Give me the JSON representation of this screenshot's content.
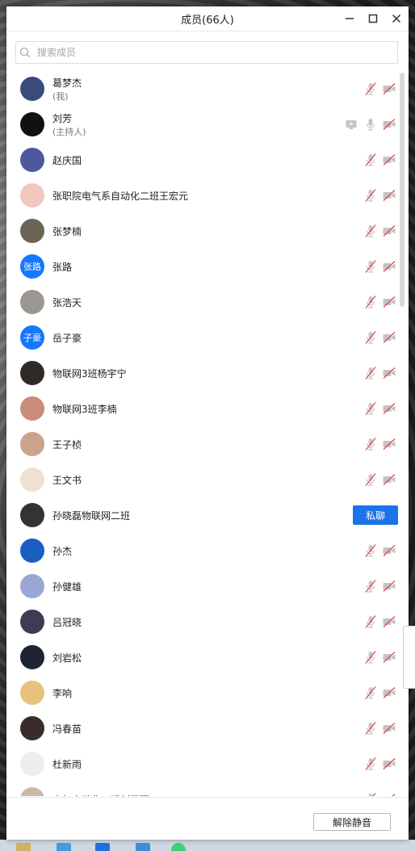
{
  "window": {
    "title": "成员(66人)"
  },
  "search": {
    "placeholder": "搜索成员"
  },
  "members": [
    {
      "name": "葛梦杰",
      "sub": "(我)",
      "avatar_color": "#3a4a7a",
      "avatar_text": "",
      "mic": "muted",
      "cam": "off"
    },
    {
      "name": "刘芳",
      "sub": "(主持人)",
      "avatar_color": "#111111",
      "avatar_text": "",
      "mic": "on",
      "cam": "off",
      "share": true
    },
    {
      "name": "赵庆国",
      "sub": "",
      "avatar_color": "#4a5a9a",
      "avatar_text": "",
      "mic": "muted",
      "cam": "off"
    },
    {
      "name": "张职院电气系自动化二班王宏元",
      "sub": "",
      "avatar_color": "#f2c7c0",
      "avatar_text": "",
      "mic": "muted",
      "cam": "off"
    },
    {
      "name": "张梦楠",
      "sub": "",
      "avatar_color": "#6b6455",
      "avatar_text": "",
      "mic": "muted",
      "cam": "off"
    },
    {
      "name": "张路",
      "sub": "",
      "avatar_color": "#1677ff",
      "avatar_text": "张路",
      "mic": "muted",
      "cam": "off"
    },
    {
      "name": "张浩天",
      "sub": "",
      "avatar_color": "#9b9690",
      "avatar_text": "",
      "mic": "muted",
      "cam": "off"
    },
    {
      "name": "岳子豪",
      "sub": "",
      "avatar_color": "#1677ff",
      "avatar_text": "子豪",
      "mic": "muted",
      "cam": "off"
    },
    {
      "name": "物联网3班杨宇宁",
      "sub": "",
      "avatar_color": "#2e2a26",
      "avatar_text": "",
      "mic": "muted",
      "cam": "off"
    },
    {
      "name": "物联网3班李楠",
      "sub": "",
      "avatar_color": "#c98b7a",
      "avatar_text": "",
      "mic": "muted",
      "cam": "off"
    },
    {
      "name": "王子桢",
      "sub": "",
      "avatar_color": "#c9a48a",
      "avatar_text": "",
      "mic": "muted",
      "cam": "off"
    },
    {
      "name": "王文书",
      "sub": "",
      "avatar_color": "#efe1d1",
      "avatar_text": "",
      "mic": "muted",
      "cam": "off"
    },
    {
      "name": "孙晓磊物联网二班",
      "sub": "",
      "avatar_color": "#333333",
      "avatar_text": "",
      "chat": true
    },
    {
      "name": "孙杰",
      "sub": "",
      "avatar_color": "#1b5fc2",
      "avatar_text": "",
      "mic": "muted",
      "cam": "off"
    },
    {
      "name": "孙健雄",
      "sub": "",
      "avatar_color": "#9aa6d6",
      "avatar_text": "",
      "mic": "muted",
      "cam": "off"
    },
    {
      "name": "吕冠晓",
      "sub": "",
      "avatar_color": "#3c3c55",
      "avatar_text": "",
      "mic": "muted",
      "cam": "off"
    },
    {
      "name": "刘岩松",
      "sub": "",
      "avatar_color": "#1e2434",
      "avatar_text": "",
      "mic": "muted",
      "cam": "off"
    },
    {
      "name": "李响",
      "sub": "",
      "avatar_color": "#e8c27a",
      "avatar_text": "",
      "mic": "muted",
      "cam": "off"
    },
    {
      "name": "冯春苗",
      "sub": "",
      "avatar_color": "#3a2c2c",
      "avatar_text": "",
      "mic": "muted",
      "cam": "off"
    },
    {
      "name": "杜新雨",
      "sub": "",
      "avatar_color": "#eeeeee",
      "avatar_text": "",
      "mic": "muted",
      "cam": "off"
    },
    {
      "name": "电气自动化二班刘王丽",
      "sub": "",
      "avatar_color": "#c9b9a9",
      "avatar_text": "",
      "mic": "muted",
      "cam": "off"
    }
  ],
  "buttons": {
    "private_chat": "私聊",
    "unmute_all": "解除静音"
  },
  "colors": {
    "accent": "#1677ff",
    "muted_red": "#e04848",
    "icon_gray": "#c4c4c4"
  }
}
